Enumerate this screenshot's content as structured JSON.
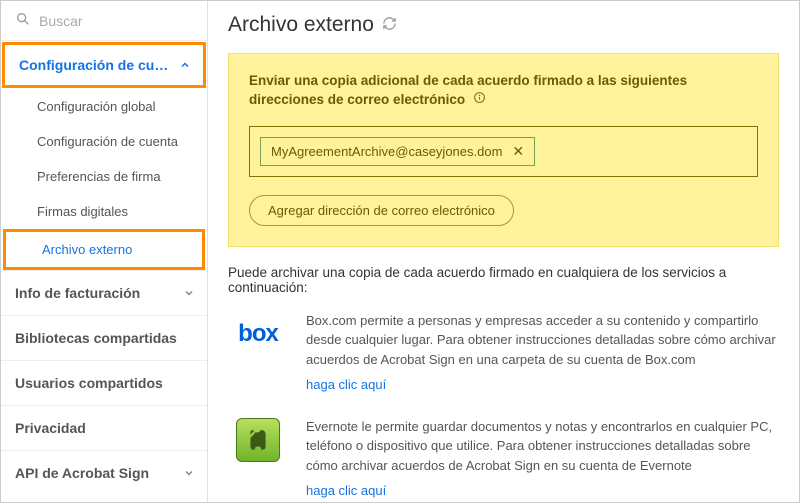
{
  "search": {
    "placeholder": "Buscar"
  },
  "sidebar": {
    "group1": {
      "label": "Configuración de cu…"
    },
    "subitems": [
      "Configuración global",
      "Configuración de cuenta",
      "Preferencias de firma",
      "Firmas digitales",
      "Archivo externo"
    ],
    "items": [
      "Info de facturación",
      "Bibliotecas compartidas",
      "Usuarios compartidos",
      "Privacidad",
      "API de Acrobat Sign"
    ]
  },
  "page": {
    "title": "Archivo externo"
  },
  "panel": {
    "title": "Enviar una copia adicional de cada acuerdo firmado a las siguientes direcciones de correo electrónico",
    "email": "MyAgreementArchive@caseyjones.dom",
    "add_btn": "Agregar dirección de correo electrónico"
  },
  "archive": {
    "intro": "Puede archivar una copia de cada acuerdo firmado en cualquiera de los servicios a continuación:",
    "box_desc": "Box.com permite a personas y empresas acceder a su contenido y compartirlo desde cualquier lugar. Para obtener instrucciones detalladas sobre cómo archivar acuerdos de Acrobat Sign en una carpeta de su cuenta de Box.com",
    "box_link": "haga clic aquí",
    "evernote_desc": "Evernote le permite guardar documentos y notas y encontrarlos en cualquier PC, teléfono o dispositivo que utilice. Para obtener instrucciones detalladas sobre cómo archivar acuerdos de Acrobat Sign en su cuenta de Evernote",
    "evernote_link": "haga clic aquí"
  }
}
